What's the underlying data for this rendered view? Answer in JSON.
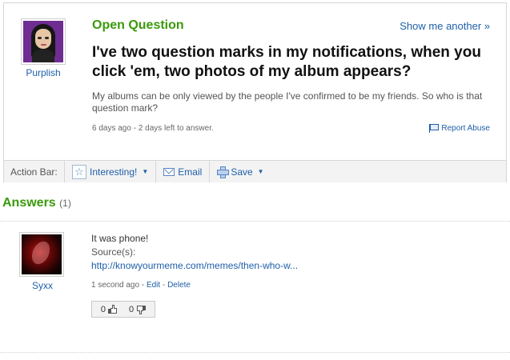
{
  "question": {
    "asker": "Purplish",
    "type_label": "Open Question",
    "show_another": "Show me another »",
    "title": "I've two question marks in my notifications, when you click 'em, two photos of my album appears?",
    "body": "My albums can be only viewed by the people I've confirmed to be my friends. So who is that question mark?",
    "meta": "6 days ago - 2 days left to answer.",
    "report_abuse": "Report Abuse"
  },
  "action_bar": {
    "label": "Action Bar:",
    "interesting": "Interesting!",
    "email": "Email",
    "save": "Save",
    "caret": "▼",
    "star_glyph": "☆"
  },
  "answers": {
    "heading": "Answers",
    "count": "(1)",
    "items": [
      {
        "author": "Syxx",
        "text": "It was phone!",
        "source_label": "Source(s):",
        "source_link": "http://knowyourmeme.com/memes/then-who-w...",
        "time": "1 second ago",
        "sep1": " - ",
        "edit": "Edit",
        "sep2": " - ",
        "delete": "Delete",
        "thumbs_up": "0",
        "thumbs_down": "0"
      }
    ]
  },
  "colors": {
    "accent_green": "#3a9a0a",
    "link_blue": "#1f5fa8",
    "border": "#d6d6d6"
  }
}
